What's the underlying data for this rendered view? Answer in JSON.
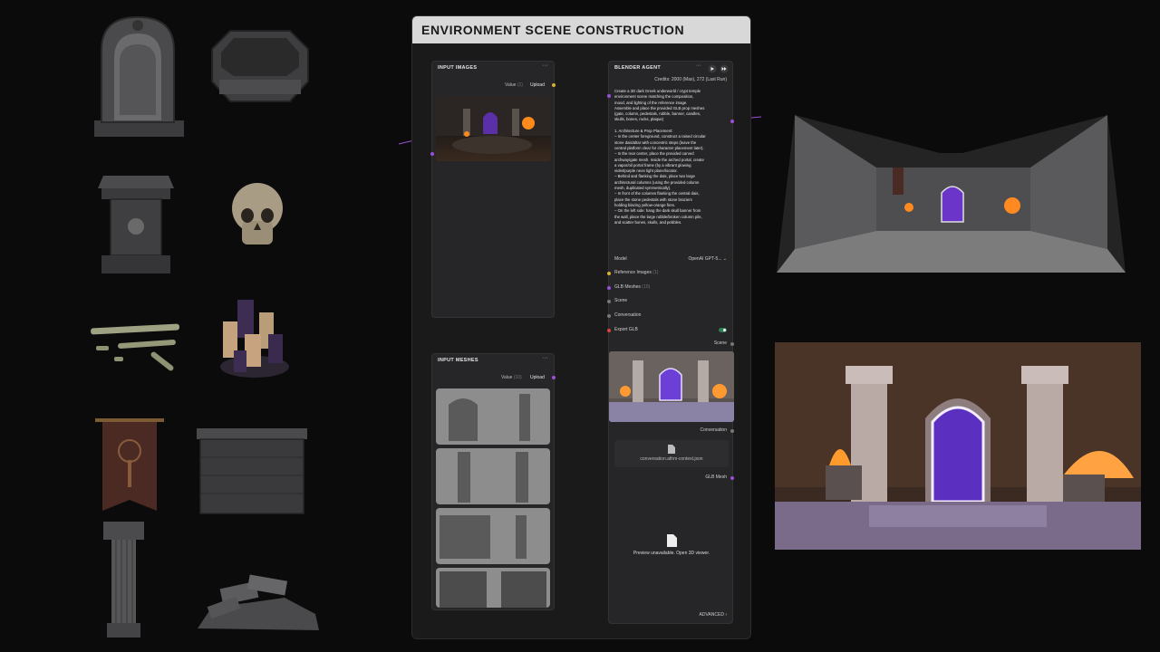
{
  "frame": {
    "title": "ENVIRONMENT SCENE CONSTRUCTION"
  },
  "input_images": {
    "title": "INPUT IMAGES",
    "value_label": "Value",
    "value_count": "(1)",
    "upload_label": "Upload",
    "menu": "···"
  },
  "input_meshes": {
    "title": "INPUT MESHES",
    "value_label": "Value",
    "value_count": "(10)",
    "upload_label": "Upload",
    "menu": "···"
  },
  "blender_agent": {
    "title": "BLENDER AGENT",
    "menu": "···",
    "credits": "Credits: 2000 (Max), 272 (Last Run)",
    "prompt": "Create a 3D dark Greek underworld / crypt temple\nenvironment scene matching the composition,\nmood, and lighting of the reference image.\nAssemble and place the provided GLB prop meshes\n(gate, column, pedestals, rubble, banner, candles,\nskulls, bones, rocks, plaque)\n\n1. Architecture & Prop Placement:\n– In the center foreground, construct a raised circular\nstone dais/altar with concentric steps (leave the\ncentral platform clear for character placement later).\n– In the rear center, place the provided carved\narchway/gate mesh. Inside the arched portal, create\na vapor/oil portal frame (by a vibrant glowing\nviolet/purple neon light plane/locator.\n– Behind and flanking the dais, place two large\narchitectural columns (using the provided column\nmesh, duplicated symmetrically).\n– In front of the columns flanking the central dais,\nplace the stone pedestals with stone braziers\nholding blazing yellow-orange fires.\n– On the left side: hang the dark skull banner from\nthe wall, place the large rubble/broken column pile,\nand scatter bones, skulls, and pebbles.",
    "model_label": "Model",
    "model_value": "OpenAI GPT-5...",
    "inputs": [
      "Reference Images",
      "GLB Meshes",
      "Scene",
      "Conversation",
      "Export GLB"
    ],
    "reference_count": "(1)",
    "mesh_count": "(10)",
    "scene_out": "Scene",
    "conversation_out": "Conversation",
    "conversation_file": "conversation.athm-context.json",
    "glb_out": "GLB Mesh",
    "preview_unavailable": "Preview unavailable. Open 3D viewer.",
    "advanced": "ADVANCED"
  },
  "colors": {
    "accent_purple": "#9d4fd9",
    "accent_yellow": "#d8b032",
    "toggle_green": "#2f7d55",
    "title_bar": "#d8d8d8"
  },
  "icons": [
    "tombstone-icon",
    "octagon-planter-icon",
    "pedestal-icon",
    "skull-icon",
    "bones-icon",
    "candles-icon",
    "banner-icon",
    "stone-wall-icon",
    "column-icon",
    "rubble-icon",
    "play-icon",
    "fast-forward-icon",
    "file-icon"
  ]
}
